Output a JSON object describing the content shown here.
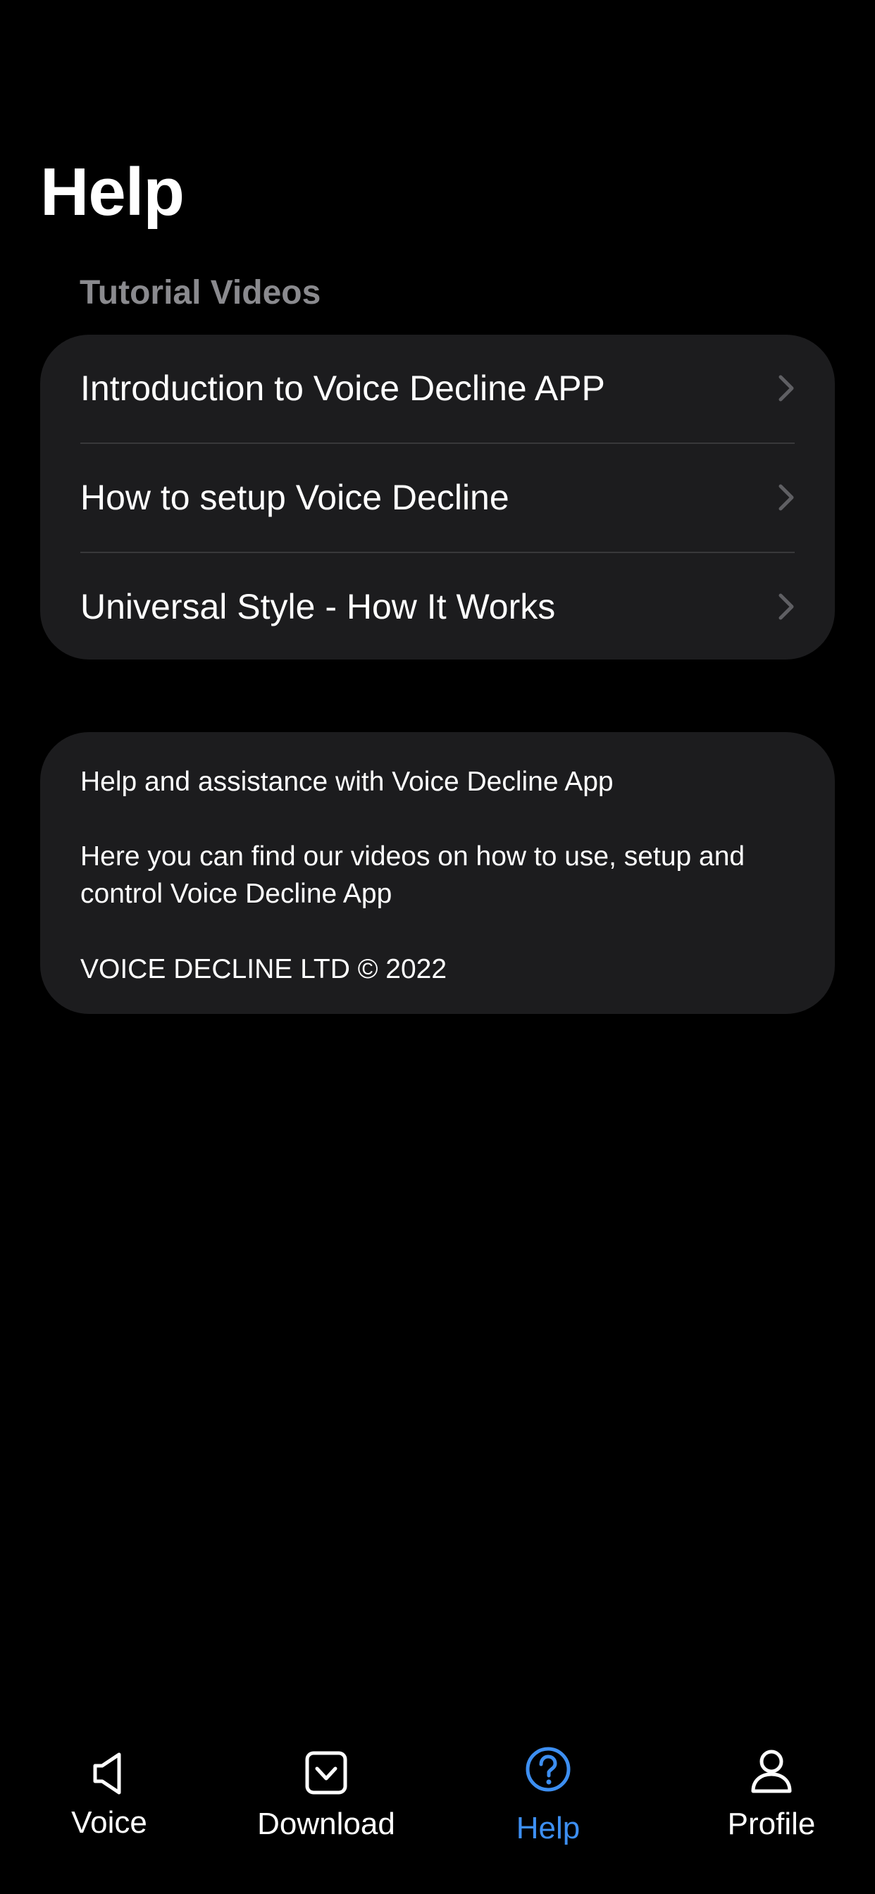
{
  "header": {
    "title": "Help"
  },
  "tutorials": {
    "section_title": "Tutorial Videos",
    "items": [
      {
        "label": "Introduction to Voice Decline APP",
        "icon": "chevron-right-icon"
      },
      {
        "label": "How to setup Voice Decline",
        "icon": "chevron-right-icon"
      },
      {
        "label": "Universal Style - How It Works",
        "icon": "chevron-right-icon"
      }
    ]
  },
  "info": {
    "heading": "Help and assistance with Voice Decline App",
    "description": "Here you can find our videos on how to use, setup and control Voice Decline App",
    "copyright": "VOICE DECLINE LTD © 2022"
  },
  "tab_bar": {
    "tabs": [
      {
        "label": "Voice",
        "icon": "speaker-icon",
        "active": false
      },
      {
        "label": "Download",
        "icon": "download-box-icon",
        "active": false
      },
      {
        "label": "Help",
        "icon": "question-circle-icon",
        "active": true
      },
      {
        "label": "Profile",
        "icon": "person-icon",
        "active": false
      }
    ]
  },
  "colors": {
    "background": "#000000",
    "card": "#1c1c1e",
    "secondary_text": "#8a8a8e",
    "active_tab": "#3d8ff2",
    "inactive_tab": "#ffffff"
  }
}
